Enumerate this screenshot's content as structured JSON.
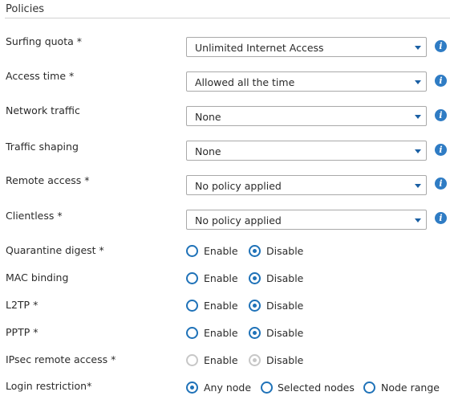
{
  "section": {
    "title": "Policies"
  },
  "selects": [
    {
      "label": "Surfing quota *",
      "value": "Unlimited Internet Access"
    },
    {
      "label": "Access time *",
      "value": "Allowed all the time"
    },
    {
      "label": "Network traffic",
      "value": "None"
    },
    {
      "label": "Traffic shaping",
      "value": "None"
    },
    {
      "label": "Remote access *",
      "value": "No policy applied"
    },
    {
      "label": "Clientless *",
      "value": "No policy applied"
    }
  ],
  "info_icon": {
    "glyph": "i",
    "icon": "info-icon",
    "color": "#2f7cc4"
  },
  "radios": [
    {
      "label": "Quarantine digest *",
      "options": [
        "Enable",
        "Disable"
      ],
      "selected": "Disable",
      "disabled": false
    },
    {
      "label": "MAC binding",
      "options": [
        "Enable",
        "Disable"
      ],
      "selected": "Disable",
      "disabled": false
    },
    {
      "label": "L2TP *",
      "options": [
        "Enable",
        "Disable"
      ],
      "selected": "Disable",
      "disabled": false
    },
    {
      "label": "PPTP *",
      "options": [
        "Enable",
        "Disable"
      ],
      "selected": "Disable",
      "disabled": false
    },
    {
      "label": "IPsec remote access *",
      "options": [
        "Enable",
        "Disable"
      ],
      "selected": "Disable",
      "disabled": true
    }
  ],
  "login_restriction": {
    "label": "Login restriction*",
    "options": [
      "Any node",
      "Selected nodes",
      "Node range"
    ],
    "selected": "Any node"
  },
  "colors": {
    "accent": "#1f72b8",
    "caret": "#1a5fa3",
    "disabled": "#c7c7c7"
  }
}
